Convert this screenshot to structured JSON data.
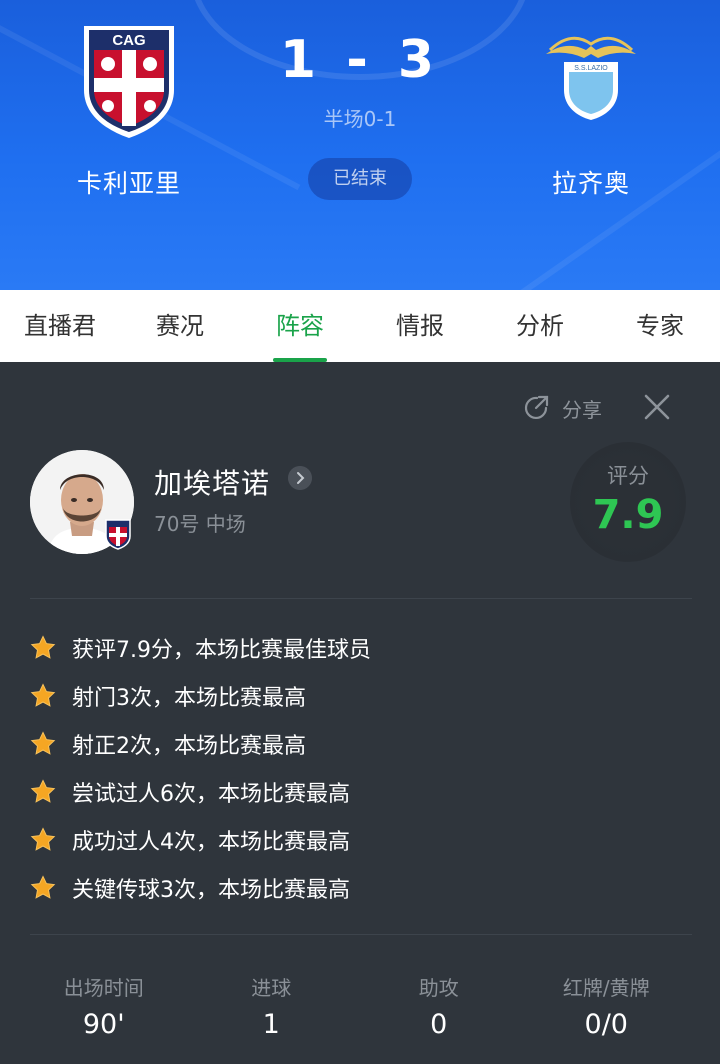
{
  "header": {
    "home_team": "卡利亚里",
    "away_team": "拉齐奥",
    "score": "1 - 3",
    "halftime": "半场0-1",
    "status": "已结束",
    "home_logo_text": "CAG",
    "away_logo_text": "S.S.LAZIO"
  },
  "tabs": [
    {
      "label": "直播君",
      "active": false
    },
    {
      "label": "赛况",
      "active": false
    },
    {
      "label": "阵容",
      "active": true
    },
    {
      "label": "情报",
      "active": false
    },
    {
      "label": "分析",
      "active": false
    },
    {
      "label": "专家",
      "active": false
    }
  ],
  "panel": {
    "share_label": "分享",
    "player": {
      "name": "加埃塔诺",
      "meta": "70号 中场",
      "rating_label": "评分",
      "rating": "7.9"
    },
    "highlights": [
      "获评7.9分，本场比赛最佳球员",
      "射门3次，本场比赛最高",
      "射正2次，本场比赛最高",
      "尝试过人6次，本场比赛最高",
      "成功过人4次，本场比赛最高",
      "关键传球3次，本场比赛最高"
    ],
    "stats": [
      {
        "label": "出场时间",
        "value": "90'"
      },
      {
        "label": "进球",
        "value": "1"
      },
      {
        "label": "助攻",
        "value": "0"
      },
      {
        "label": "红牌/黄牌",
        "value": "0/0"
      }
    ]
  },
  "colors": {
    "header_blue": "#1f6ff0",
    "accent_green": "#1aa34a",
    "rating_green": "#2ec653",
    "panel_bg": "#2f353c",
    "star": "#f5a623"
  }
}
